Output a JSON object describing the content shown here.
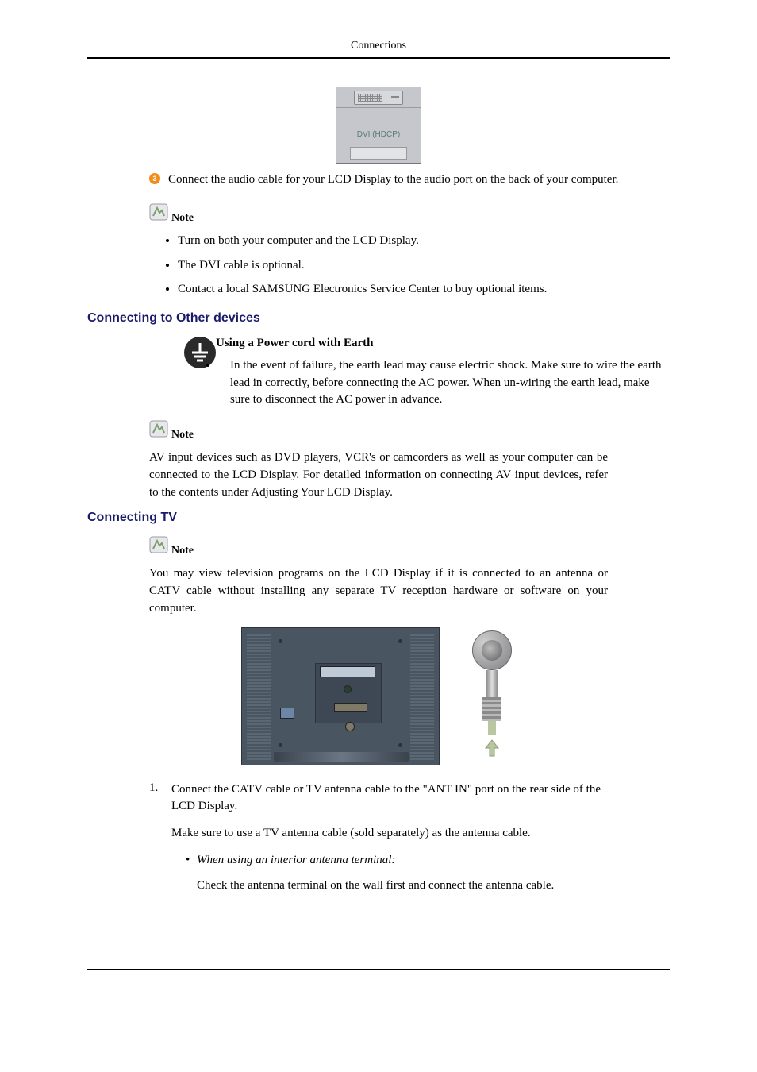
{
  "header": {
    "title": "Connections"
  },
  "port_figure": {
    "label": "DVI (HDCP)"
  },
  "step3": {
    "number": "3",
    "text": "Connect the audio cable for your LCD Display to the audio port on the back of your computer."
  },
  "note_label": "Note",
  "notes_after_step3": [
    "Turn on both your computer and the LCD Display.",
    "The DVI cable is optional.",
    "Contact a local SAMSUNG Electronics Service Center to buy optional items."
  ],
  "section_other": {
    "heading": "Connecting to Other devices",
    "earth_title": "Using a Power cord with Earth",
    "earth_body": "In the event of failure, the earth lead may cause electric shock. Make sure to wire the earth lead in correctly, before connecting the AC power. When un-wiring the earth lead, make sure to disconnect the AC power in advance.",
    "av_para": "AV input devices such as DVD players, VCR's or camcorders as well as your computer can be connected to the LCD Display. For detailed information on connecting AV input devices, refer to the contents under Adjusting Your LCD Display."
  },
  "section_tv": {
    "heading": "Connecting TV",
    "intro": "You may view television programs on the LCD Display if it is connected to an antenna or CATV cable without installing any separate TV reception hardware or software on your computer.",
    "step1_num": "1.",
    "step1_text": "Connect the CATV cable or TV antenna cable to the \"ANT IN\" port on the rear side of the LCD Display.",
    "step1_sub": "Make sure to use a TV antenna cable (sold separately) as the antenna cable.",
    "bullet_label": "When using an interior antenna terminal:",
    "bullet_body": "Check the antenna terminal on the wall first and connect the antenna cable."
  }
}
